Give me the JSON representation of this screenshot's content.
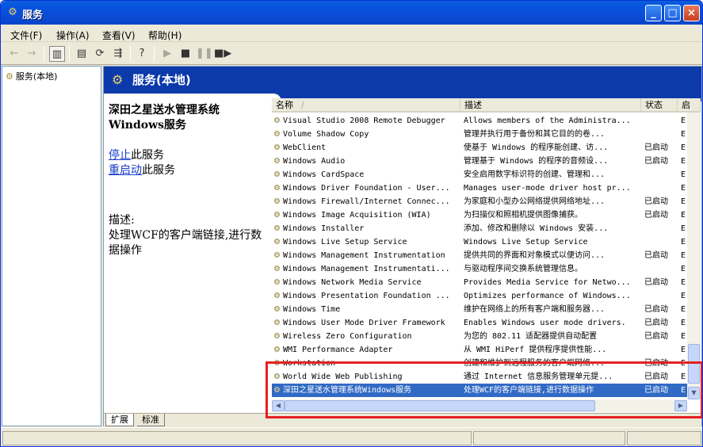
{
  "window": {
    "title": "服务",
    "icon": "gears-icon",
    "buttons": {
      "minimize": "_",
      "maximize": "□",
      "close": "×"
    }
  },
  "menu": [
    "文件(F)",
    "操作(A)",
    "查看(V)",
    "帮助(H)"
  ],
  "toolbar": [
    "back-icon",
    "forward-icon",
    "show-hide-tree-icon",
    "properties-icon",
    "refresh-icon",
    "export-list-icon",
    "help-icon",
    "start-service-icon",
    "stop-service-icon",
    "pause-service-icon",
    "restart-service-icon"
  ],
  "tree": {
    "root": "服务(本地)"
  },
  "header": {
    "title": "服务(本地)"
  },
  "detail": {
    "title": "深田之星送水管理系统Windows服务",
    "stop_link": "停止",
    "stop_suffix": "此服务",
    "restart_link": "重启动",
    "restart_suffix": "此服务",
    "desc_label": "描述:",
    "desc_text": "处理WCF的客户端链接,进行数据操作"
  },
  "columns": [
    "名称",
    "描述",
    "状态",
    "启"
  ],
  "sort_indicator": "/",
  "rows": [
    {
      "name": "Visual Studio 2008 Remote Debugger",
      "desc": "Allows members of the Administra...",
      "status": "",
      "start": "E"
    },
    {
      "name": "Volume Shadow Copy",
      "desc": "管理并执行用于备份和其它目的的卷...",
      "status": "",
      "start": "E"
    },
    {
      "name": "WebClient",
      "desc": "使基于 Windows 的程序能创建、访...",
      "status": "已启动",
      "start": "E"
    },
    {
      "name": "Windows Audio",
      "desc": "管理基于 Windows 的程序的音频设...",
      "status": "已启动",
      "start": "E"
    },
    {
      "name": "Windows CardSpace",
      "desc": "安全启用数字标识符的创建、管理和...",
      "status": "",
      "start": "E"
    },
    {
      "name": "Windows Driver Foundation - User...",
      "desc": "Manages user-mode driver host pr...",
      "status": "",
      "start": "E"
    },
    {
      "name": "Windows Firewall/Internet Connec...",
      "desc": "为家庭和小型办公网络提供网络地址...",
      "status": "已启动",
      "start": "E"
    },
    {
      "name": "Windows Image Acquisition (WIA)",
      "desc": "为扫描仪和照相机提供图像捕获。",
      "status": "已启动",
      "start": "E"
    },
    {
      "name": "Windows Installer",
      "desc": "添加、修改和删除以 Windows 安装...",
      "status": "",
      "start": "E"
    },
    {
      "name": "Windows Live Setup Service",
      "desc": "Windows Live Setup Service",
      "status": "",
      "start": "E"
    },
    {
      "name": "Windows Management Instrumentation",
      "desc": "提供共同的界面和对象模式以便访问...",
      "status": "已启动",
      "start": "E"
    },
    {
      "name": "Windows Management Instrumentati...",
      "desc": "与驱动程序间交换系统管理信息。",
      "status": "",
      "start": "E"
    },
    {
      "name": "Windows Network Media Service",
      "desc": "Provides Media Service for Netwo...",
      "status": "已启动",
      "start": "E"
    },
    {
      "name": "Windows Presentation Foundation ...",
      "desc": "Optimizes performance of Windows...",
      "status": "",
      "start": "E"
    },
    {
      "name": "Windows Time",
      "desc": "维护在网络上的所有客户端和服务器...",
      "status": "已启动",
      "start": "E"
    },
    {
      "name": "Windows User Mode Driver Framework",
      "desc": "Enables Windows user mode drivers.",
      "status": "已启动",
      "start": "E"
    },
    {
      "name": "Wireless Zero Configuration",
      "desc": "为您的 802.11 适配器提供自动配置",
      "status": "已启动",
      "start": "E"
    },
    {
      "name": "WMI Performance Adapter",
      "desc": "从 WMI HiPerf 提供程序提供性能...",
      "status": "",
      "start": "E"
    },
    {
      "name": "Workstation",
      "desc": "创建和维护到远程服务的客户端网络...",
      "status": "已启动",
      "start": "E"
    },
    {
      "name": "World Wide Web Publishing",
      "desc": "通过 Internet 信息服务管理单元提...",
      "status": "已启动",
      "start": "E"
    },
    {
      "name": "深田之星送水管理系统Windows服务",
      "desc": "处理WCF的客户端链接,进行数据操作",
      "status": "已启动",
      "start": "E"
    }
  ],
  "selected_row": 20,
  "tabs": [
    "扩展",
    "标准"
  ],
  "colors": {
    "title": "#0a4bd4",
    "header": "#0c3aab",
    "selection": "#316ac5",
    "highlight": "#e52020"
  }
}
